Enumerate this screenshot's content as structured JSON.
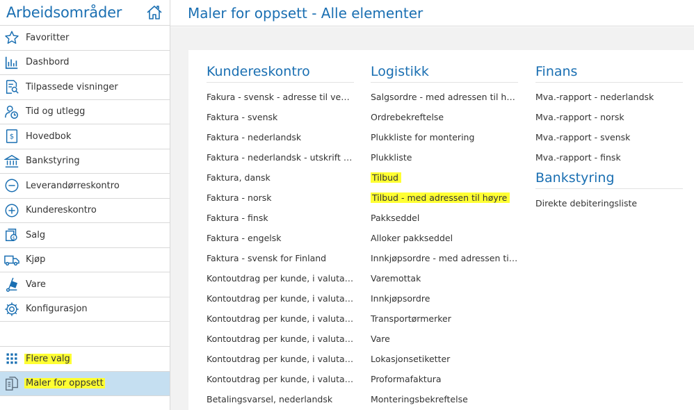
{
  "sidebar": {
    "title": "Arbeidsområder",
    "items": [
      {
        "label": "Favoritter",
        "icon": "star-icon"
      },
      {
        "label": "Dashbord",
        "icon": "bar-chart-icon"
      },
      {
        "label": "Tilpassede visninger",
        "icon": "custom-view-icon"
      },
      {
        "label": "Tid og utlegg",
        "icon": "time-expense-icon"
      },
      {
        "label": "Hovedbok",
        "icon": "ledger-icon"
      },
      {
        "label": "Bankstyring",
        "icon": "bank-icon"
      },
      {
        "label": "Leverandørreskontro",
        "icon": "minus-circle-icon"
      },
      {
        "label": "Kundereskontro",
        "icon": "plus-circle-icon"
      },
      {
        "label": "Salg",
        "icon": "sales-icon"
      },
      {
        "label": "Kjøp",
        "icon": "truck-icon"
      },
      {
        "label": "Vare",
        "icon": "hand-truck-icon"
      },
      {
        "label": "Konfigurasjon",
        "icon": "gear-icon"
      }
    ],
    "bottom_items": [
      {
        "label": "Flere valg",
        "icon": "grid-icon"
      },
      {
        "label": "Maler for oppsett",
        "icon": "templates-icon"
      }
    ]
  },
  "header": {
    "title": "Maler for oppsett - Alle elementer"
  },
  "colors": {
    "accent": "#1a6fb2",
    "active_bg": "#c5dff1",
    "highlight": "#ffff33"
  },
  "columns": {
    "kundereskontro": {
      "title": "Kundereskontro",
      "items": [
        "Fakura - svensk - adresse til venstre",
        "Faktura - svensk",
        "Faktura - nederlandsk",
        "Faktura - nederlandsk - utskrift på fo...",
        "Faktura, dansk",
        "Faktura - norsk",
        "Faktura - finsk",
        "Faktura - engelsk",
        "Faktura - svensk for Finland",
        "Kontoutdrag per kunde, i valuta - sv...",
        "Kontoutdrag per kunde, i valuta - sv...",
        "Kontoutdrag per kunde, i valuta - en...",
        "Kontoutdrag per kunde, i valuta - no...",
        "Kontoutdrag per kunde, i valuta - finsk",
        "Kontoutdrag per kunde, i valuta - ne...",
        "Betalingsvarsel, nederlandsk"
      ]
    },
    "logistikk": {
      "title": "Logistikk",
      "items": [
        "Salgsordre - med adressen til høyre",
        "Ordrebekreftelse",
        "Plukkliste for montering",
        "Plukkliste",
        "Tilbud",
        "Tilbud - med adressen til høyre",
        "Pakkseddel",
        "Alloker pakkseddel",
        "Innkjøpsordre - med adressen til hø...",
        "Varemottak",
        "Innkjøpsordre",
        "Transportørmerker",
        "Vare",
        "Lokasjonsetiketter",
        "Proformafaktura",
        "Monteringsbekreftelse"
      ]
    },
    "finans": {
      "title": "Finans",
      "items": [
        "Mva.-rapport - nederlandsk",
        "Mva.-rapport - norsk",
        "Mva.-rapport - svensk",
        "Mva.-rapport - finsk"
      ]
    },
    "bankstyring": {
      "title": "Bankstyring",
      "items": [
        "Direkte debiteringsliste"
      ]
    }
  }
}
